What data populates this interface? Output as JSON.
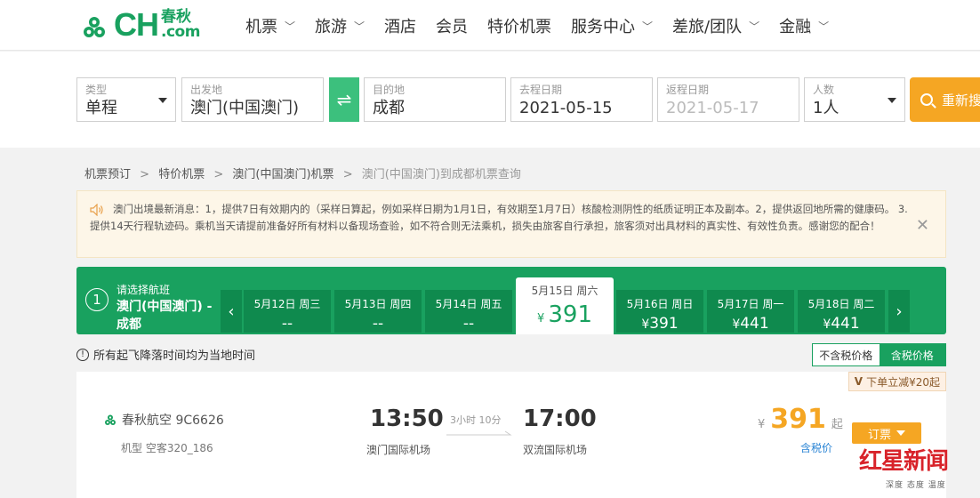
{
  "header": {
    "logo_cn": "春秋",
    "logo_ch": "CH",
    "logo_com": ".com",
    "nav": [
      {
        "label": "机票",
        "has_dropdown": true
      },
      {
        "label": "旅游",
        "has_dropdown": true
      },
      {
        "label": "酒店",
        "has_dropdown": false
      },
      {
        "label": "会员",
        "has_dropdown": false
      },
      {
        "label": "特价机票",
        "has_dropdown": false
      },
      {
        "label": "服务中心",
        "has_dropdown": true
      },
      {
        "label": "差旅/团队",
        "has_dropdown": true
      },
      {
        "label": "金融",
        "has_dropdown": true
      }
    ],
    "chevron_glyph": "﹀"
  },
  "search": {
    "type": {
      "label": "类型",
      "value": "单程"
    },
    "from": {
      "label": "出发地",
      "value": "澳门(中国澳门)"
    },
    "to": {
      "label": "目的地",
      "value": "成都"
    },
    "depart_date": {
      "label": "去程日期",
      "value": "2021-05-15"
    },
    "return_date": {
      "label": "返程日期",
      "value": "2021-05-17"
    },
    "passengers": {
      "label": "人数",
      "value": "1人"
    },
    "swap_icon": "⇌",
    "research_label": "重新搜索"
  },
  "breadcrumb": {
    "items": [
      "机票预订",
      "特价机票",
      "澳门(中国澳门)机票",
      "澳门(中国澳门)到成都机票查询"
    ],
    "sep": ">"
  },
  "notice": {
    "text": "澳门出境最新消息：1，提供7日有效期内的（采样日算起，例如采样日期为1月1日，有效期至1月7日）核酸检测阴性的纸质证明正本及副本。2，提供返回地所需的健康码。 3. 提供14天行程轨迹码。乘机当天请提前准备好所有材料以备现场查验，如不符合则无法乘机，损失由旅客自行承担，旅客须对出具材料的真实性、有效性负责。感谢您的配合！",
    "close_glyph": "✕"
  },
  "dates": {
    "step_num": "1",
    "step_label": "请选择航班",
    "route": "澳门(中国澳门) - 成都",
    "prev_glyph": "‹",
    "next_glyph": "›",
    "items": [
      {
        "date": "5月12日 周三",
        "price": "--",
        "currency": ""
      },
      {
        "date": "5月13日 周四",
        "price": "--",
        "currency": ""
      },
      {
        "date": "5月14日 周五",
        "price": "--",
        "currency": ""
      },
      {
        "date": "5月15日 周六",
        "price": "391",
        "currency": "¥",
        "active": true
      },
      {
        "date": "5月16日 周日",
        "price": "391",
        "currency": "¥"
      },
      {
        "date": "5月17日 周一",
        "price": "441",
        "currency": "¥"
      },
      {
        "date": "5月18日 周二",
        "price": "441",
        "currency": "¥"
      }
    ]
  },
  "notes": {
    "tz": "所有起飞降落时间均为当地时间",
    "info_glyph": "!",
    "tax_off": "不含税价格",
    "tax_on": "含税价格"
  },
  "flight": {
    "promo": "下单立减¥20起",
    "promo_glyph": "V",
    "airline": "春秋航空 9C6626",
    "plane": "机型 空客320_186",
    "dep_time": "13:50",
    "arr_time": "17:00",
    "dep_airport": "澳门国际机场",
    "arr_airport": "双流国际机场",
    "duration": "3小时 10分",
    "currency": "¥",
    "price": "391",
    "price_suffix": "起",
    "tax_link": "含税价",
    "book_label": "订票"
  },
  "watermark": {
    "main": "红星新闻",
    "sub": "深度 态度 温度"
  },
  "colors": {
    "brand_green": "#19a15f",
    "accent_orange": "#f5a623"
  }
}
